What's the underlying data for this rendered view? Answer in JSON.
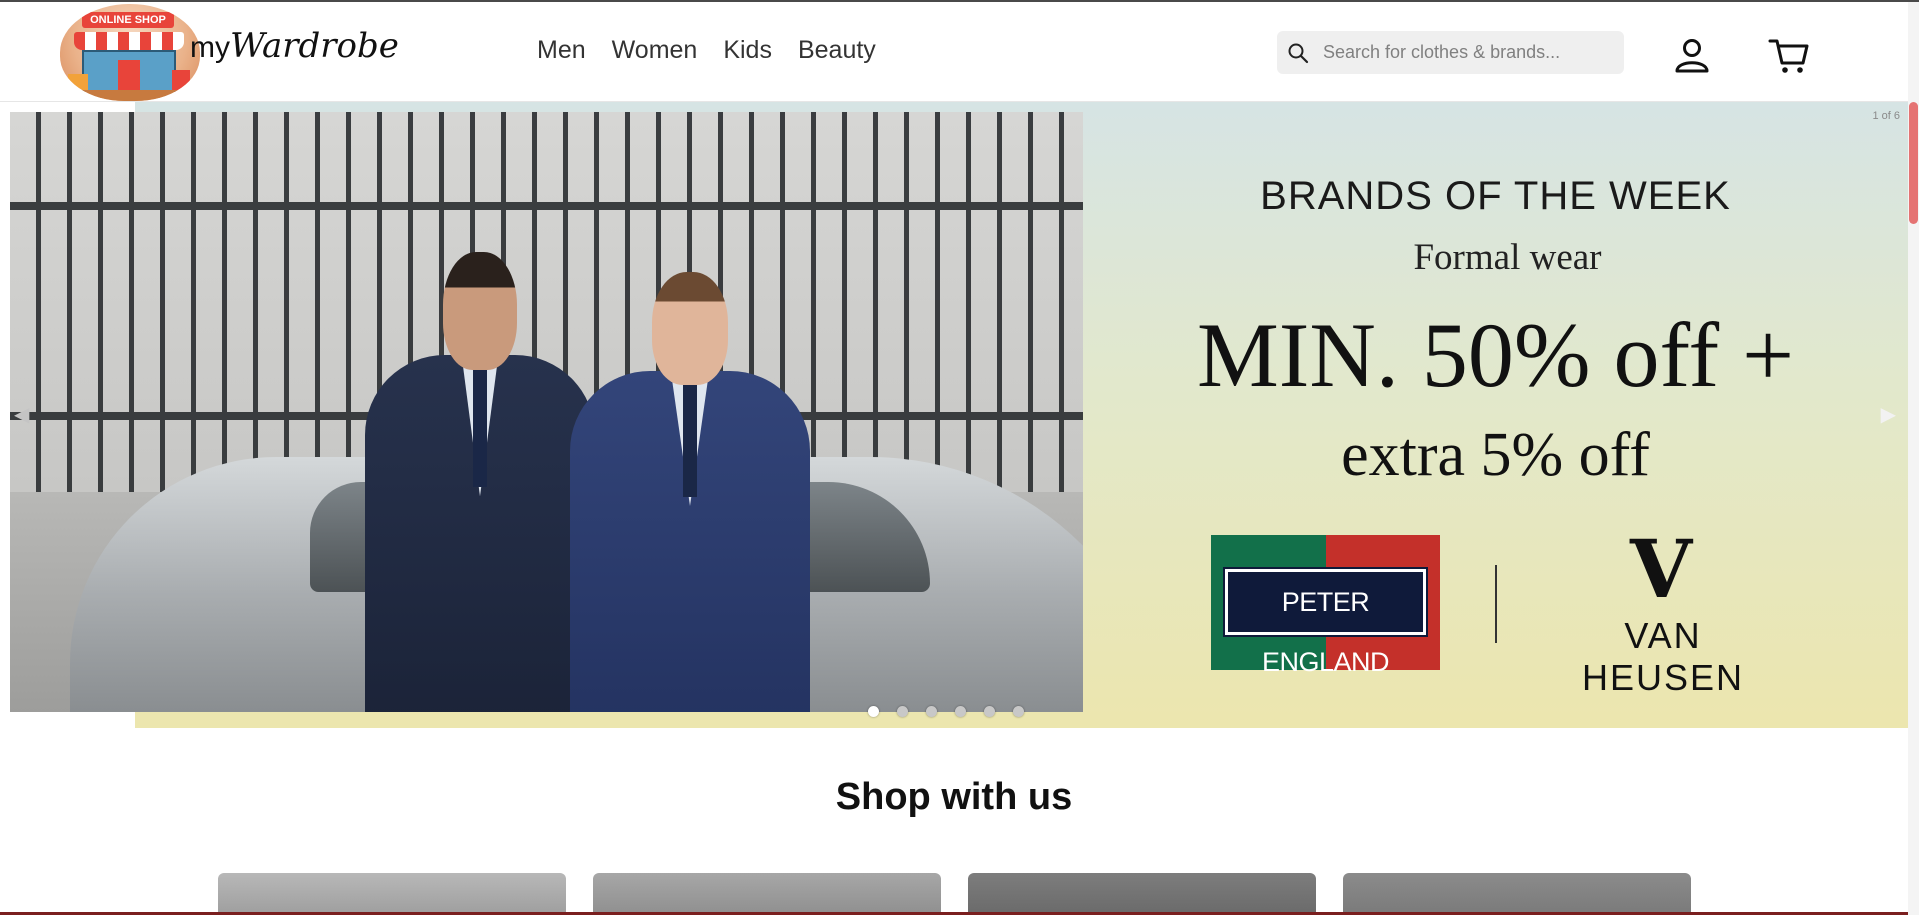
{
  "header": {
    "logo": {
      "badge_text": "ONLINE SHOP",
      "text_prefix": "my",
      "text_script": "Wardrobe"
    },
    "nav": [
      {
        "label": "Men"
      },
      {
        "label": "Women"
      },
      {
        "label": "Kids"
      },
      {
        "label": "Beauty"
      }
    ],
    "search": {
      "placeholder": "Search for clothes & brands...",
      "icon": "search-icon"
    },
    "user_icon": "user-icon",
    "cart_icon": "cart-icon"
  },
  "banner": {
    "counter": "1 of 6",
    "slides_total": 6,
    "active_slide": 1,
    "promo": {
      "heading": "BRANDS OF THE WEEK",
      "subheading": "Formal wear",
      "offer_main": "MIN. 50% off +",
      "offer_extra": "extra 5% off",
      "brand_1": "PETER ENGLAND",
      "brand_2_mark": "V",
      "brand_2": "VAN HEUSEN"
    }
  },
  "section": {
    "title": "Shop with us"
  },
  "colors": {
    "scroll_thumb": "#e57373",
    "peter_england_green": "#12704a",
    "peter_england_red": "#c4302a",
    "promo_bg_top": "#d6e4e4",
    "promo_bg_bottom": "#ece6ae"
  }
}
